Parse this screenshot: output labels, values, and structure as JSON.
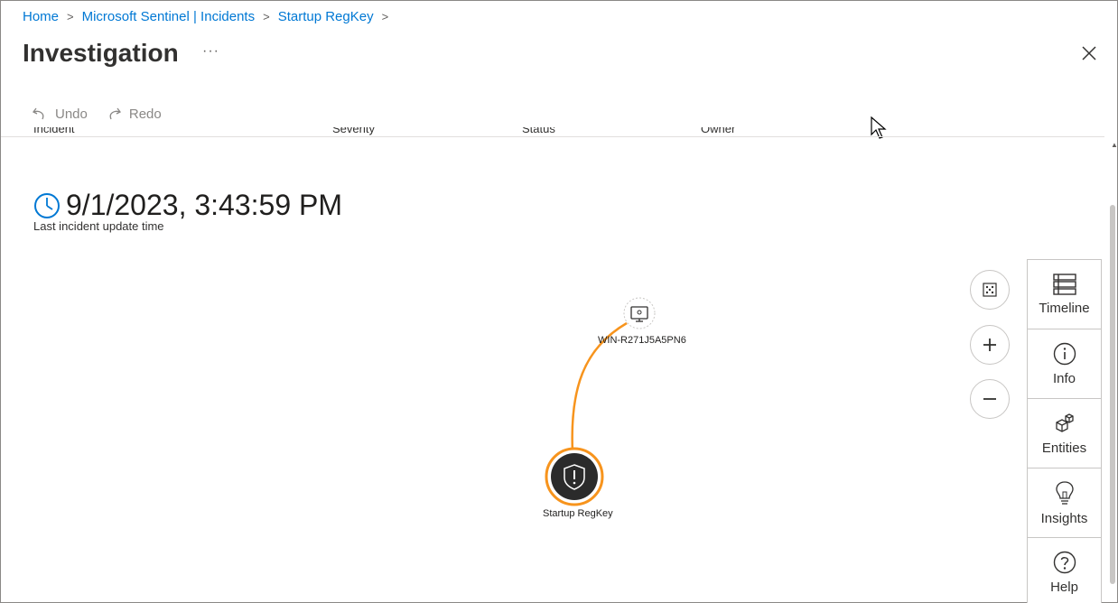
{
  "breadcrumb": {
    "items": [
      "Home",
      "Microsoft Sentinel | Incidents",
      "Startup RegKey"
    ]
  },
  "header": {
    "title": "Investigation",
    "more": "···"
  },
  "toolbar": {
    "undo_label": "Undo",
    "redo_label": "Redo"
  },
  "summary_row": {
    "labels": [
      "Incident",
      "Severity",
      "Status",
      "Owner"
    ]
  },
  "last_update": {
    "time": "9/1/2023, 3:43:59 PM",
    "label": "Last incident update time"
  },
  "graph": {
    "nodes": [
      {
        "name": "WIN-R271J5A5PN6",
        "type": "host",
        "icon": "computer-icon"
      },
      {
        "name": "Startup RegKey",
        "type": "alert",
        "icon": "shield-alert-icon"
      }
    ],
    "edge_color": "#f7941d",
    "alert_ring_color": "#f7941d",
    "alert_fill_color": "#2b2b2b"
  },
  "zoom_controls": {
    "icons": [
      "fit-to-screen-icon",
      "zoom-in-icon",
      "zoom-out-icon"
    ]
  },
  "side_panel": {
    "items": [
      {
        "label": "Timeline",
        "icon": "timeline-icon"
      },
      {
        "label": "Info",
        "icon": "info-icon"
      },
      {
        "label": "Entities",
        "icon": "entities-icon"
      },
      {
        "label": "Insights",
        "icon": "lightbulb-icon"
      },
      {
        "label": "Help",
        "icon": "help-icon"
      }
    ]
  },
  "colors": {
    "link": "#0078d4",
    "text": "#323130",
    "disabled": "#8a8886"
  }
}
